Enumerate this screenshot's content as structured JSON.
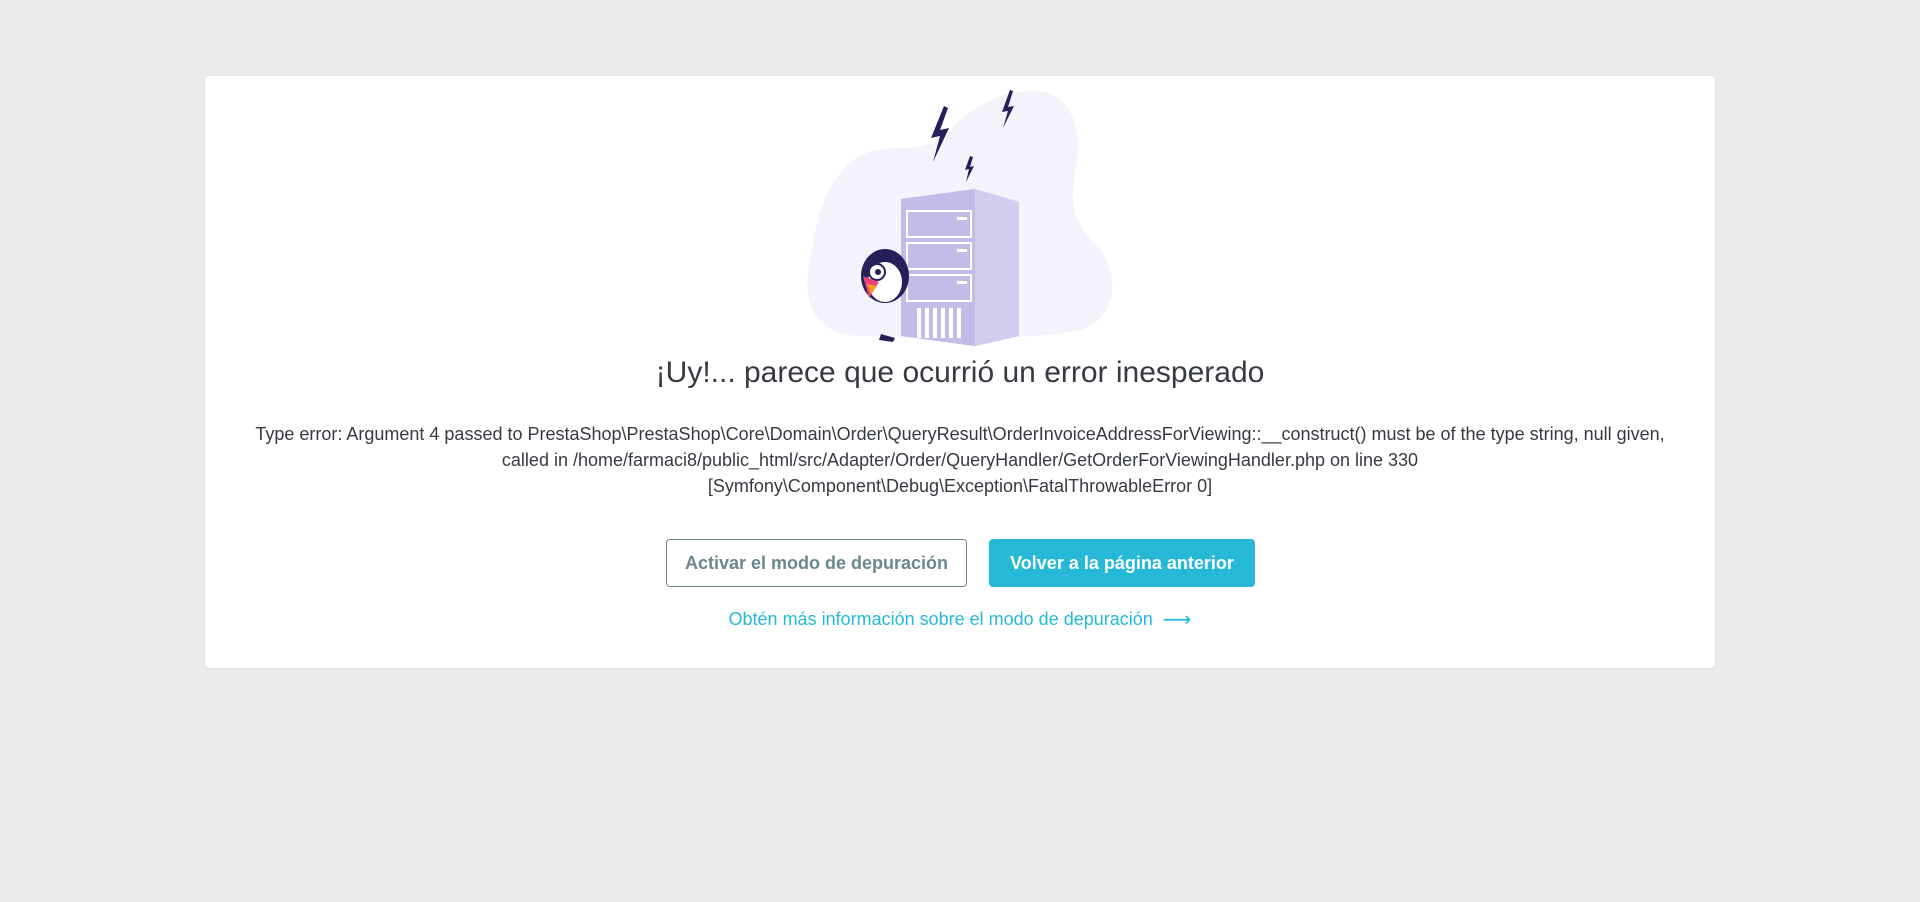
{
  "error_page": {
    "title": "¡Uy!... parece que ocurrió un error inesperado",
    "message_lines": [
      "Type error: Argument 4 passed to PrestaShop\\PrestaShop\\Core\\Domain\\Order\\QueryResult\\OrderInvoiceAddressForViewing::__construct() must be of the type string, null given,",
      "called in /home/farmaci8/public_html/src/Adapter/Order/QueryHandler/GetOrderForViewingHandler.php on line 330",
      "[Symfony\\Component\\Debug\\Exception\\FatalThrowableError 0]"
    ],
    "debug_button_label": "Activar el modo de depuración",
    "back_button_label": "Volver a la página anterior",
    "info_link_label": "Obtén más información sobre el modo de depuración",
    "info_link_arrow": "⟶"
  },
  "icons": {
    "illustration": "server-puffin-illustration",
    "arrow": "arrow-right-icon"
  },
  "colors": {
    "background": "#eaebed",
    "card": "#ffffff",
    "text": "#363a41",
    "accent": "#25b9d7",
    "secondary_border": "#6c868e",
    "server": "#bfb6e6"
  }
}
